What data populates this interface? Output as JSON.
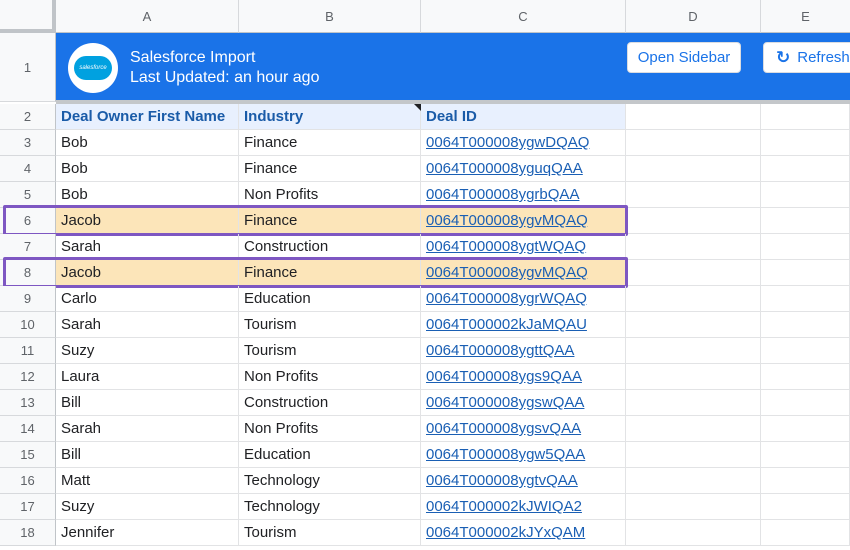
{
  "columns": [
    "A",
    "B",
    "C",
    "D",
    "E"
  ],
  "banner": {
    "logo_text": "salesforce",
    "title": "Salesforce Import",
    "subtitle": "Last Updated: an hour ago"
  },
  "buttons": {
    "open_sidebar": "Open Sidebar",
    "refresh": "Refresh",
    "refresh_icon": "↻"
  },
  "row_numbers": [
    "1",
    "2",
    "3",
    "4",
    "5",
    "6",
    "7",
    "8",
    "9",
    "10",
    "11",
    "12",
    "13",
    "14",
    "15",
    "16",
    "17",
    "18"
  ],
  "table": {
    "headers": [
      "Deal Owner First Name",
      "Industry",
      "Deal ID"
    ],
    "rows": [
      [
        "Bob",
        "Finance",
        "0064T000008ygwDQAQ"
      ],
      [
        "Bob",
        "Finance",
        "0064T000008yguqQAA"
      ],
      [
        "Bob",
        "Non Profits",
        "0064T000008ygrbQAA"
      ],
      [
        "Jacob",
        "Finance",
        "0064T000008ygvMQAQ"
      ],
      [
        "Sarah",
        "Construction",
        "0064T000008ygtWQAQ"
      ],
      [
        "Jacob",
        "Finance",
        "0064T000008ygvMQAQ"
      ],
      [
        "Carlo",
        "Education",
        "0064T000008ygrWQAQ"
      ],
      [
        "Sarah",
        "Tourism",
        "0064T000002kJaMQAU"
      ],
      [
        "Suzy",
        "Tourism",
        "0064T000008ygttQAA"
      ],
      [
        "Laura",
        "Non Profits",
        "0064T000008ygs9QAA"
      ],
      [
        "Bill",
        "Construction",
        "0064T000008ygswQAA"
      ],
      [
        "Sarah",
        "Non Profits",
        "0064T000008ygsvQAA"
      ],
      [
        "Bill",
        "Education",
        "0064T000008ygw5QAA"
      ],
      [
        "Matt",
        "Technology",
        "0064T000008ygtvQAA"
      ],
      [
        "Suzy",
        "Technology",
        "0064T000002kJWIQA2"
      ],
      [
        "Jennifer",
        "Tourism",
        "0064T000002kJYxQAM"
      ]
    ]
  },
  "highlight": {
    "fill_color": "#fce5b9",
    "outline_color": "#7e57c2",
    "highlighted_sheet_rows": [
      "6",
      "8"
    ]
  },
  "colors": {
    "banner": "#1a73e8",
    "link": "#1a5fb4",
    "header_fill": "#e8f0fe"
  }
}
